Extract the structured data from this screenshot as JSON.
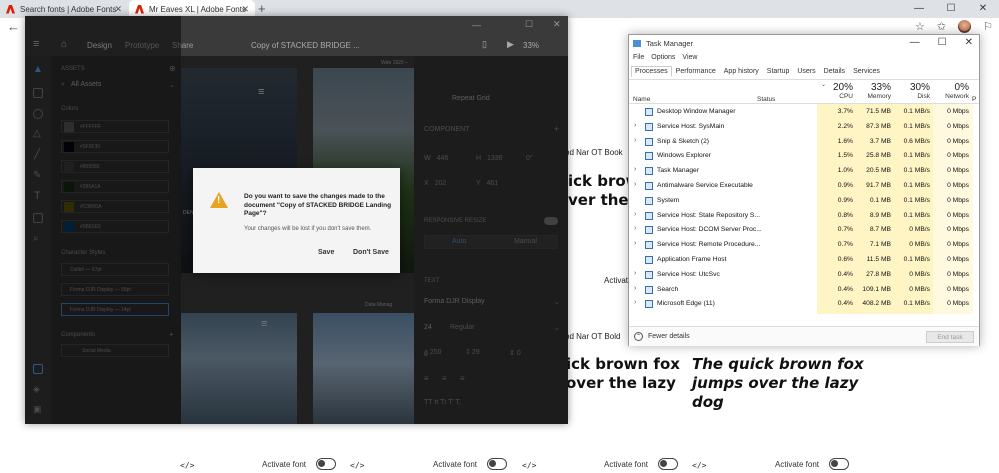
{
  "browser": {
    "tabs": [
      {
        "title": "Search fonts | Adobe Fonts",
        "close": "✕"
      },
      {
        "title": "Mr Eaves XL | Adobe Fonts",
        "close": "✕"
      }
    ],
    "new_tab": "+",
    "window_controls": [
      "—",
      "☐",
      "✕"
    ],
    "back": "←",
    "toolbar_icons": [
      "☆",
      "✩",
      "⚐"
    ]
  },
  "page": {
    "font_labels": [
      "od Nar OT Book",
      "od Nar OT Bold"
    ],
    "pangram_fragments": [
      "ick brown fo",
      "ver the lazy",
      "ick brown fox",
      "over the lazy"
    ],
    "pangram_full": [
      "The quick brown fox",
      "jumps over the lazy",
      "dog"
    ],
    "activate_partial": "Activate",
    "footer": [
      {
        "code": "</>",
        "activate": "Activate font"
      },
      {
        "code": "</>",
        "activate": "Activate font"
      },
      {
        "code": "</>",
        "activate": "Activate font"
      },
      {
        "code": "</>",
        "activate": "Activate font"
      }
    ]
  },
  "xd": {
    "menu": {
      "design": "Design",
      "prototype": "Prototype",
      "share": "Share",
      "doc_title": "Copy of STACKED BRIDGE ...",
      "zoom": "33%"
    },
    "assets": {
      "header": "ASSETS",
      "filter": "All Assets",
      "colors_title": "Colors",
      "colors": [
        {
          "hex": "#FFFFFF",
          "label": "#FFFFFF"
        },
        {
          "hex": "#0F0F30",
          "label": "#0F0F30"
        },
        {
          "hex": "#808080",
          "label": "#808080"
        },
        {
          "hex": "#285A1A",
          "label": "#285A1A"
        },
        {
          "hex": "#C0B00A",
          "label": "#C0B00A"
        },
        {
          "hex": "#0B81E0",
          "label": "#0B81E0"
        }
      ],
      "char_styles_title": "Character Styles",
      "char_styles": [
        "Calibri — 67pt",
        "Forma DJR Display — 55pt",
        "Forma DJR Display — 14pt"
      ],
      "components_title": "Components",
      "components": [
        "Social Media"
      ]
    },
    "canvas": {
      "web_label": "Web 1920 –",
      "data_label": "Data Manag",
      "den_label": "DEN"
    },
    "props": {
      "repeat_grid": "Repeat Grid",
      "component_title": "COMPONENT",
      "w": "446",
      "h": "1336",
      "x": "202",
      "y": "461",
      "rotation": "0°",
      "responsive_resize": "RESPONSIVE RESIZE",
      "auto": "Auto",
      "manual": "Manual",
      "text_title": "TEXT",
      "font": "Forma DJR Display",
      "size": "24",
      "weight": "Regular",
      "char_spacing": "250",
      "line_spacing": "29",
      "para_spacing": "0"
    },
    "dialog": {
      "message": "Do you want to save the changes made to the document \"Copy of STACKED BRIDGE Landing Page\"?",
      "sub": "Your changes will be lost if you don't save them.",
      "save": "Save",
      "dont_save": "Don't Save"
    }
  },
  "task_manager": {
    "title": "Task Manager",
    "window_controls": [
      "—",
      "☐",
      "✕"
    ],
    "menu": [
      "File",
      "Options",
      "View"
    ],
    "tabs": [
      "Processes",
      "Performance",
      "App history",
      "Startup",
      "Users",
      "Details",
      "Services"
    ],
    "active_tab": "Processes",
    "columns": {
      "name": "Name",
      "status": "Status",
      "cpu": {
        "pct": "20%",
        "label": "CPU"
      },
      "memory": {
        "pct": "33%",
        "label": "Memory"
      },
      "disk": {
        "pct": "30%",
        "label": "Disk"
      },
      "network": {
        "pct": "0%",
        "label": "Network"
      },
      "power": "P"
    },
    "rows": [
      {
        "name": "Desktop Window Manager",
        "expand": "",
        "cpu": "3.7%",
        "memory": "71.5 MB",
        "disk": "0.1 MB/s",
        "network": "0 Mbps"
      },
      {
        "name": "Service Host: SysMain",
        "expand": "›",
        "cpu": "2.2%",
        "memory": "87.3 MB",
        "disk": "0.1 MB/s",
        "network": "0 Mbps"
      },
      {
        "name": "Snip & Sketch (2)",
        "expand": "›",
        "cpu": "1.6%",
        "memory": "3.7 MB",
        "disk": "0.6 MB/s",
        "network": "0 Mbps"
      },
      {
        "name": "Windows Explorer",
        "expand": "",
        "cpu": "1.5%",
        "memory": "25.8 MB",
        "disk": "0.1 MB/s",
        "network": "0 Mbps"
      },
      {
        "name": "Task Manager",
        "expand": "›",
        "cpu": "1.0%",
        "memory": "20.5 MB",
        "disk": "0.1 MB/s",
        "network": "0 Mbps"
      },
      {
        "name": "Antimalware Service Executable",
        "expand": "›",
        "cpu": "0.9%",
        "memory": "91.7 MB",
        "disk": "0.1 MB/s",
        "network": "0 Mbps"
      },
      {
        "name": "System",
        "expand": "",
        "cpu": "0.9%",
        "memory": "0.1 MB",
        "disk": "0.1 MB/s",
        "network": "0 Mbps"
      },
      {
        "name": "Service Host: State Repository S...",
        "expand": "›",
        "cpu": "0.8%",
        "memory": "8.9 MB",
        "disk": "0.1 MB/s",
        "network": "0 Mbps"
      },
      {
        "name": "Service Host: DCOM Server Proc...",
        "expand": "›",
        "cpu": "0.7%",
        "memory": "8.7 MB",
        "disk": "0 MB/s",
        "network": "0 Mbps"
      },
      {
        "name": "Service Host: Remote Procedure...",
        "expand": "›",
        "cpu": "0.7%",
        "memory": "7.1 MB",
        "disk": "0 MB/s",
        "network": "0 Mbps"
      },
      {
        "name": "Application Frame Host",
        "expand": "",
        "cpu": "0.6%",
        "memory": "11.5 MB",
        "disk": "0.1 MB/s",
        "network": "0 Mbps"
      },
      {
        "name": "Service Host: UtcSvc",
        "expand": "›",
        "cpu": "0.4%",
        "memory": "27.8 MB",
        "disk": "0 MB/s",
        "network": "0 Mbps"
      },
      {
        "name": "Search",
        "expand": "›",
        "cpu": "0.4%",
        "memory": "109.1 MB",
        "disk": "0 MB/s",
        "network": "0 Mbps"
      },
      {
        "name": "Microsoft Edge (11)",
        "expand": "›",
        "cpu": "0.4%",
        "memory": "408.2 MB",
        "disk": "0.1 MB/s",
        "network": "0 Mbps"
      }
    ],
    "fewer_details": "Fewer details",
    "end_task": "End task"
  }
}
